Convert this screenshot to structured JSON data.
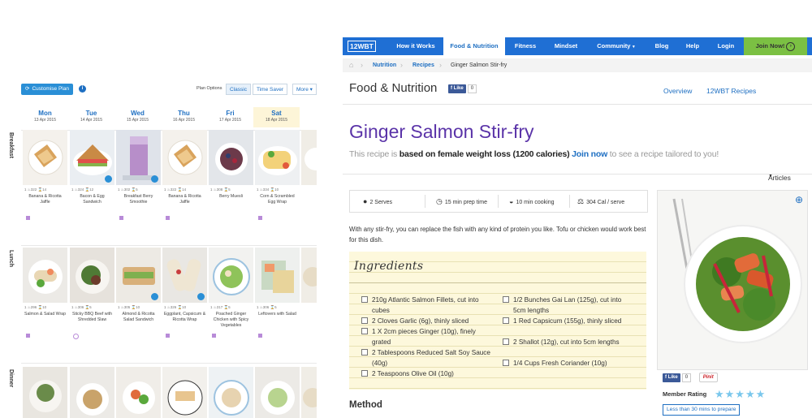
{
  "planner": {
    "customise_label": "Customise Plan",
    "info_icon": "i",
    "plan_options_label": "Plan Options",
    "plan_buttons": [
      "Classic",
      "Time Saver",
      "More"
    ],
    "days": [
      {
        "name": "Mon",
        "date": "13 Apr 2015"
      },
      {
        "name": "Tue",
        "date": "14 Apr 2015"
      },
      {
        "name": "Wed",
        "date": "15 Apr 2015"
      },
      {
        "name": "Thu",
        "date": "16 Apr 2015"
      },
      {
        "name": "Fri",
        "date": "17 Apr 2015"
      },
      {
        "name": "Sat",
        "date": "18 Apr 2015"
      }
    ],
    "sections": [
      "Breakfast",
      "Lunch",
      "Dinner"
    ],
    "breakfast": [
      {
        "stats": "1 ♨322 ⌛14",
        "name": "Banana & Ricotta Jaffle"
      },
      {
        "stats": "1 ♨324 ⌛12",
        "name": "Bacon & Egg Sandwich"
      },
      {
        "stats": "1 ♨302 ⌛5",
        "name": "Breakfast Berry Smoothie"
      },
      {
        "stats": "1 ♨322 ⌛14",
        "name": "Banana & Ricotta Jaffle"
      },
      {
        "stats": "1 ♨308 ⌛5",
        "name": "Berry Muesli"
      },
      {
        "stats": "1 ♨334 ⌛10",
        "name": "Corn & Scrambled Egg Wrap"
      }
    ],
    "lunch": [
      {
        "stats": "1 ♨296 ⌛10",
        "name": "Salmon & Salad Wrap"
      },
      {
        "stats": "1 ♨306 ⌛5",
        "name": "Sticky BBQ Beef with Shredded Slaw"
      },
      {
        "stats": "1 ♨305 ⌛10",
        "name": "Almond & Ricotta Salad Sandwich"
      },
      {
        "stats": "1 ♨326 ⌛10",
        "name": "Eggplant, Capsicum & Ricotta Wrap"
      },
      {
        "stats": "1 ♨317 ⌛5",
        "name": "Poached Ginger Chicken with Spicy Vegetables"
      },
      {
        "stats": "1 ♨306 ⌛5",
        "name": "Leftovers with Salad"
      }
    ]
  },
  "site": {
    "nav": [
      "12WBT",
      "How it Works",
      "Food & Nutrition",
      "Fitness",
      "Mindset",
      "Community",
      "Blog",
      "Help",
      "Login",
      "Join Now!"
    ],
    "breadcrumb": [
      "Nutrition",
      "Recipes",
      "Ginger Salmon Stir-fry"
    ],
    "section_title": "Food & Nutrition",
    "fb_like": "Like",
    "fb_count": "0",
    "subnav": [
      "Overview",
      "12WBT Recipes",
      "Articles"
    ],
    "recipe_title": "Ginger Salmon Stir-fry",
    "sub_prefix": "This recipe is",
    "sub_bold": "based on female weight loss (1200 calories)",
    "sub_join": "Join now",
    "sub_suffix": "to see a recipe tailored to you!",
    "info": [
      "2 Serves",
      "15 min prep time",
      "10 min cooking",
      "304 Cal / serve"
    ],
    "intro": "With any stir-fry, you can replace the fish with any kind of protein you like. Tofu or chicken would work best for this dish.",
    "ingredients_heading": "Ingredients",
    "ingredients_left": [
      "210g Atlantic Salmon Fillets, cut into cubes",
      "2 Cloves Garlic (6g), thinly sliced",
      "1 X 2cm pieces Ginger (10g), finely grated",
      "2 Tablespoons Reduced Salt Soy Sauce (40g)",
      "2 Teaspoons Olive Oil (10g)"
    ],
    "ingredients_right": [
      "1/2 Bunches Gai Lan (125g), cut into 5cm lengths",
      "1 Red Capsicum (155g), thinly sliced",
      "2 Shallot (12g), cut into 5cm lengths",
      "1/4 Cups Fresh Coriander (10g)"
    ],
    "method_heading": "Method",
    "pin_label": "Pinit",
    "member_rating_label": "Member Rating",
    "stars": "★★★★★",
    "time_badge": "Less than 30 mins to prepare"
  }
}
